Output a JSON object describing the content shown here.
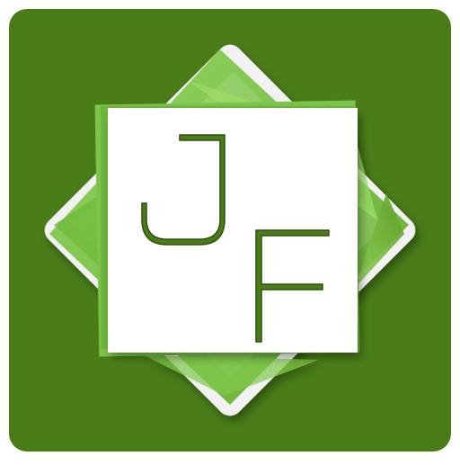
{
  "logo": {
    "icon_name": "jf-monogram-app-icon",
    "letters": [
      "J",
      "F"
    ],
    "colors": {
      "background": "#4a7d18",
      "light_green": "#7cc44a",
      "mid_green": "#5a9a26",
      "white": "#ffffff",
      "letter_fill": "#4a7d18"
    }
  }
}
